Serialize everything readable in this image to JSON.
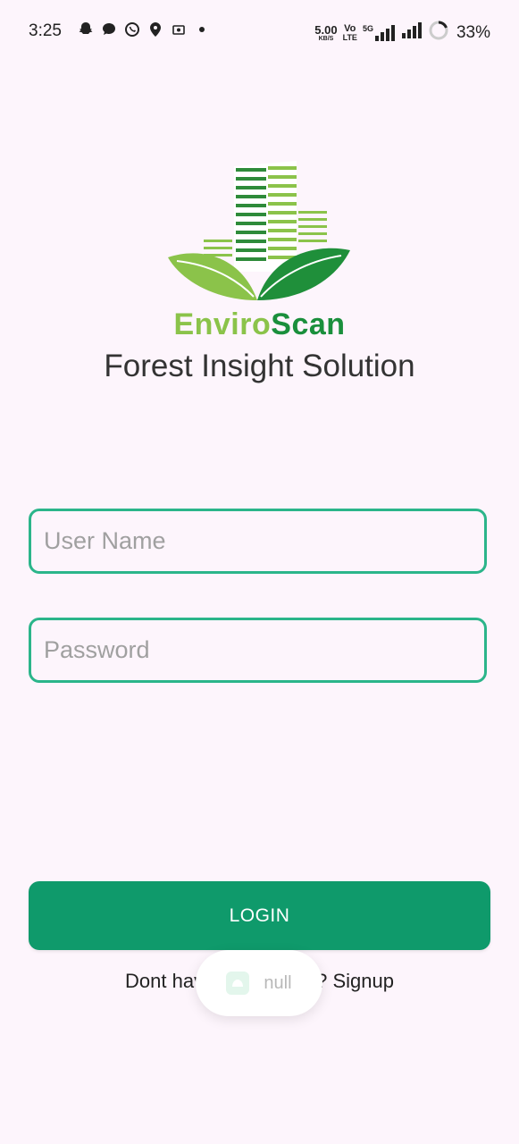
{
  "status_bar": {
    "time": "3:25",
    "net_speed_value": "5.00",
    "net_speed_unit": "KB/S",
    "volte_top": "Vo",
    "volte_bottom": "LTE",
    "network_type": "5G",
    "battery_percent": "33%",
    "left_icons": [
      "snapchat-icon",
      "chat-icon",
      "whatsapp-icon",
      "app-icon",
      "screen-record-icon",
      "dot-icon"
    ]
  },
  "brand": {
    "name_part1": "Enviro",
    "name_part2": "Scan",
    "tagline": "Forest Insight Solution",
    "colors": {
      "light_green": "#8bc34a",
      "dark_green": "#1a8f3c"
    }
  },
  "form": {
    "username_placeholder": "User Name",
    "username_value": "",
    "password_placeholder": "Password",
    "password_value": "",
    "field_border_color": "#2bb58a"
  },
  "login": {
    "label": "LOGIN",
    "color": "#0f9a6b"
  },
  "signup": {
    "prompt_visible_start": "Dont hav",
    "prompt_visible_end": "? Signup"
  },
  "toast": {
    "text": "null"
  }
}
